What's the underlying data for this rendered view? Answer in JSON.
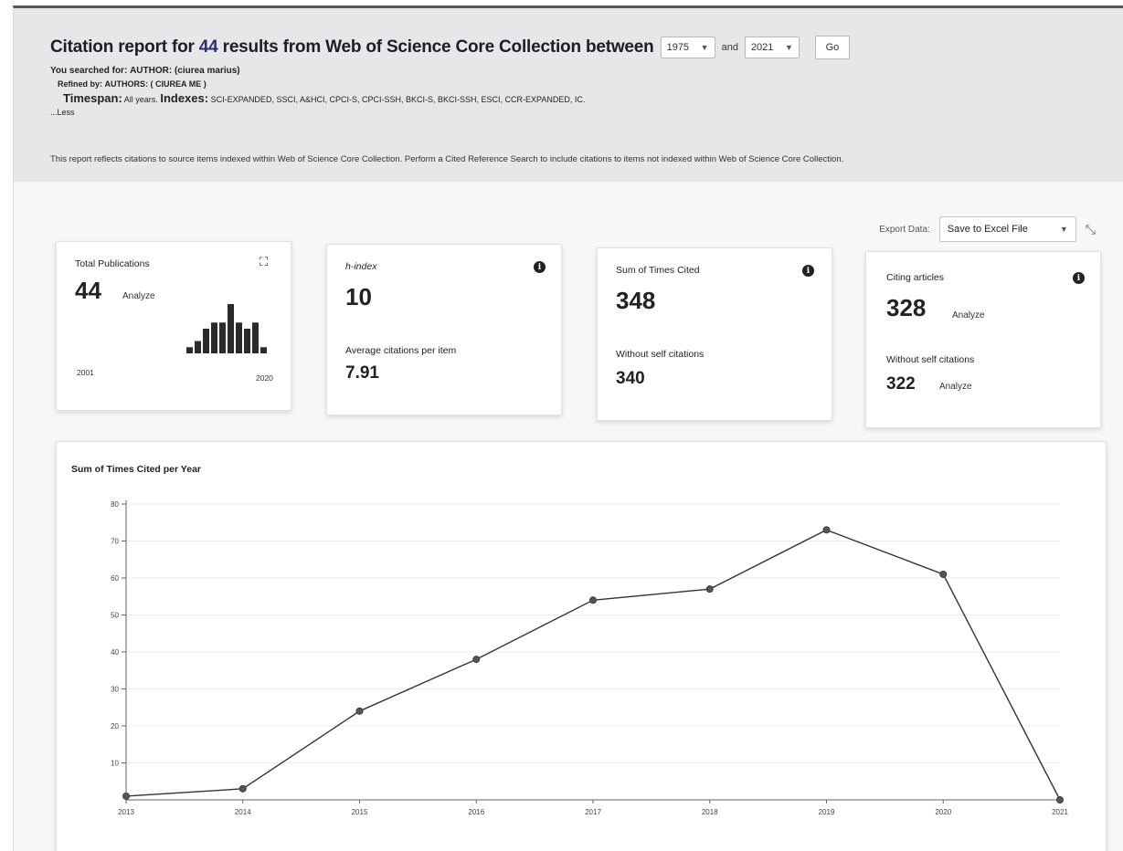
{
  "header": {
    "title_prefix": "Citation report for",
    "result_count": "44",
    "title_suffix": "results from Web of Science Core Collection between",
    "from_year": "1975",
    "and_label": "and",
    "to_year": "2021",
    "go_label": "Go",
    "searched_label": "You searched for:",
    "searched_value": "AUTHOR: (ciurea marius)",
    "refined_label": "Refined by:",
    "refined_value": "AUTHORS: ( CIUREA ME )",
    "timespan_label": "Timespan:",
    "timespan_value": "All years.",
    "indexes_label": "Indexes:",
    "indexes_value": "SCI-EXPANDED, SSCI, A&HCI, CPCI-S, CPCI-SSH, BKCI-S, BKCI-SSH, ESCI, CCR-EXPANDED, IC.",
    "less_label": "...Less",
    "note": "This report reflects citations to source items indexed within Web of Science Core Collection. Perform a Cited Reference Search to include citations to items not indexed within Web of Science Core Collection."
  },
  "export": {
    "label": "Export Data:",
    "selected": "Save to Excel File"
  },
  "cards": {
    "total_publications": {
      "label": "Total Publications",
      "value": "44",
      "analyze": "Analyze",
      "start_year": "2001",
      "end_year": "2020",
      "histogram": [
        1,
        2,
        4,
        5,
        5,
        8,
        5,
        4,
        5,
        1
      ]
    },
    "h_index": {
      "label": "h-index",
      "value": "10",
      "avg_label": "Average citations per item",
      "avg_value": "7.91"
    },
    "sum_times_cited": {
      "label": "Sum of Times Cited",
      "value": "348",
      "without_label": "Without self citations",
      "without_value": "340"
    },
    "citing_articles": {
      "label": "Citing articles",
      "value": "328",
      "analyze": "Analyze",
      "without_label": "Without self citations",
      "without_value": "322",
      "analyze2": "Analyze"
    }
  },
  "chart_data": {
    "type": "line",
    "title": "Sum of Times Cited per Year",
    "x": [
      "2013",
      "2014",
      "2015",
      "2016",
      "2017",
      "2018",
      "2019",
      "2020",
      "2021"
    ],
    "values": [
      1,
      3,
      24,
      38,
      54,
      57,
      73,
      61,
      0
    ],
    "ylim": [
      0,
      80
    ],
    "yticks": [
      10,
      20,
      30,
      40,
      50,
      60,
      70,
      80
    ],
    "grid": true,
    "colors": {
      "line": "#333333",
      "point": "#555555"
    }
  }
}
